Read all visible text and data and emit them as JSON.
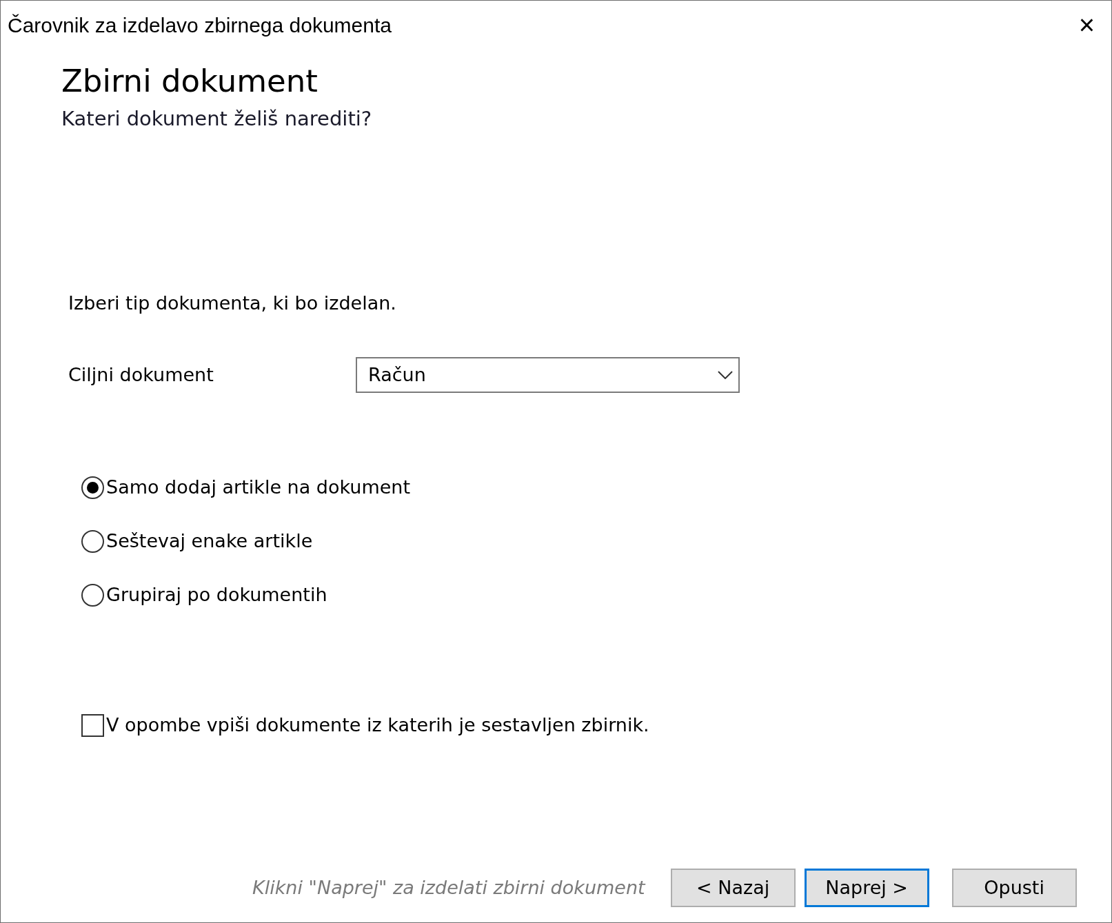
{
  "window": {
    "title": "Čarovnik za izdelavo zbirnega dokumenta",
    "close": "×"
  },
  "header": {
    "title": "Zbirni dokument",
    "subtitle": "Kateri dokument želiš narediti?"
  },
  "instruction": "Izberi tip dokumenta, ki bo izdelan.",
  "target_document": {
    "label": "Ciljni dokument",
    "value": "Račun"
  },
  "options": [
    {
      "label": "Samo dodaj artikle na dokument",
      "selected": true
    },
    {
      "label": "Seštevaj enake artikle",
      "selected": false
    },
    {
      "label": "Grupiraj po dokumentih",
      "selected": false
    }
  ],
  "notes_checkbox": {
    "label": "V opombe vpiši dokumente iz katerih je sestavljen zbirnik.",
    "checked": false
  },
  "hint": "Klikni \"Naprej\" za izdelati zbirni dokument",
  "buttons": [
    {
      "label": "< Nazaj",
      "focused": false
    },
    {
      "label": "Naprej >",
      "focused": true
    },
    {
      "label": "Opusti",
      "focused": false
    }
  ]
}
